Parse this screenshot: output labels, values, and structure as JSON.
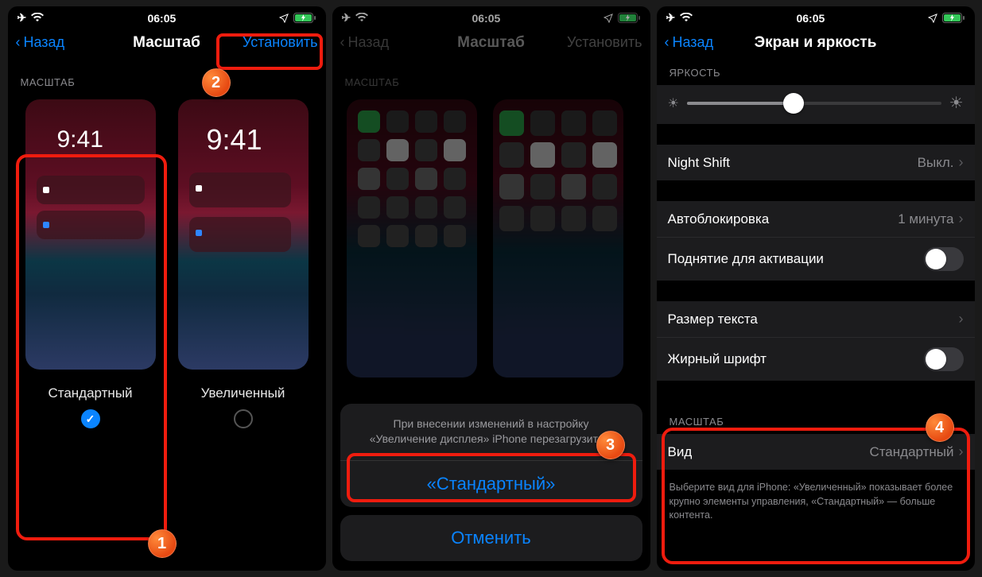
{
  "status": {
    "time": "06:05"
  },
  "screen1": {
    "back": "Назад",
    "title": "Масштаб",
    "action": "Установить",
    "section": "МАСШТАБ",
    "option_standard": "Стандартный",
    "option_zoomed": "Увеличенный",
    "preview_time": "9:41"
  },
  "screen2": {
    "back": "Назад",
    "title": "Масштаб",
    "action": "Установить",
    "section": "МАСШТАБ",
    "sheet_msg": "При внесении изменений в настройку «Увеличение дисплея» iPhone перезагрузится.",
    "sheet_confirm": "«Стандартный»",
    "sheet_cancel": "Отменить"
  },
  "screen3": {
    "back": "Назад",
    "title": "Экран и яркость",
    "brightness_header": "ЯРКОСТЬ",
    "night_shift": "Night Shift",
    "night_shift_value": "Выкл.",
    "autolock": "Автоблокировка",
    "autolock_value": "1 минута",
    "raise_to_wake": "Поднятие для активации",
    "text_size": "Размер текста",
    "bold_text": "Жирный шрифт",
    "zoom_header": "МАСШТАБ",
    "view": "Вид",
    "view_value": "Стандартный",
    "footer": "Выберите вид для iPhone: «Увеличенный» показывает более крупно элементы управления, «Стандартный» — больше контента."
  },
  "badges": {
    "n1": "1",
    "n2": "2",
    "n3": "3",
    "n4": "4"
  }
}
